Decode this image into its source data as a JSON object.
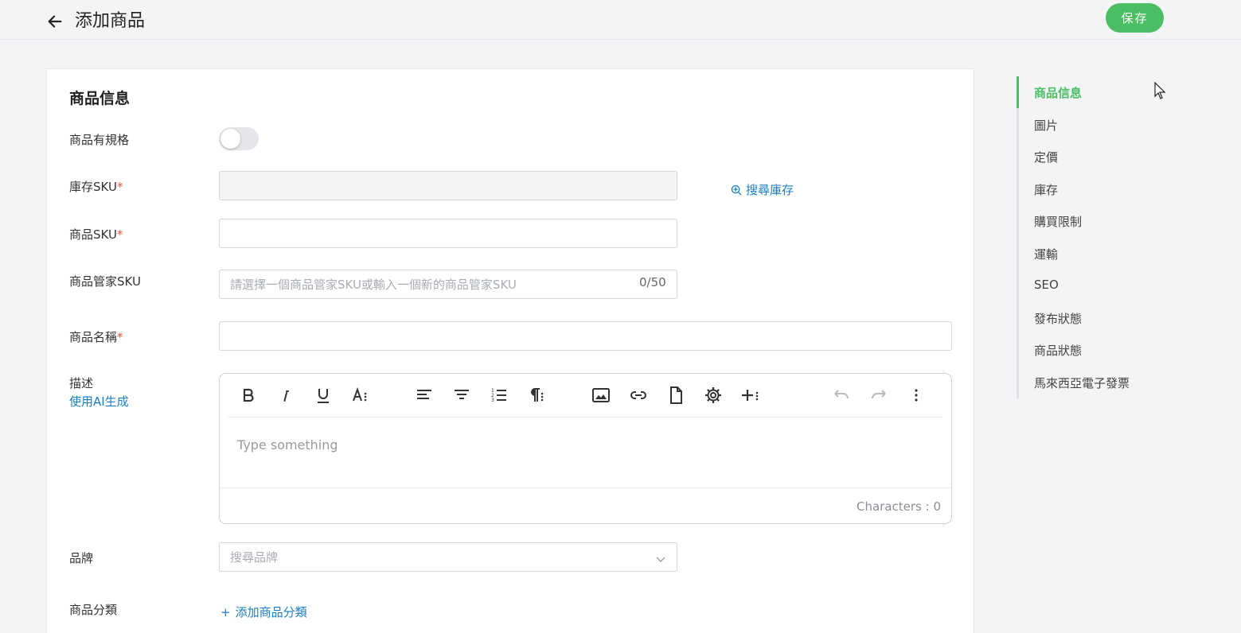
{
  "header": {
    "title": "添加商品",
    "save_label": "保存"
  },
  "form": {
    "section_title": "商品信息",
    "has_spec_label": "商品有規格",
    "stock_sku_label": "庫存SKU",
    "search_stock_label": "搜尋庫存",
    "product_sku_label": "商品SKU",
    "manager_sku_label": "商品管家SKU",
    "manager_sku_placeholder": "請選擇一個商品管家SKU或輸入一個新的商品管家SKU",
    "manager_sku_counter": "0/50",
    "product_name_label": "商品名稱",
    "required_mark": "*",
    "description_label": "描述",
    "ai_generate_label": "使用AI生成",
    "editor_placeholder": "Type something",
    "char_count": "Characters : 0",
    "brand_label": "品牌",
    "brand_placeholder": "搜尋品牌",
    "category_label": "商品分類",
    "add_category_label": "添加商品分類"
  },
  "sidenav": {
    "items": [
      {
        "label": "商品信息",
        "active": true
      },
      {
        "label": "圖片"
      },
      {
        "label": "定價"
      },
      {
        "label": "庫存"
      },
      {
        "label": "購買限制"
      },
      {
        "label": "運輸"
      },
      {
        "label": "SEO"
      },
      {
        "label": "發布狀態"
      },
      {
        "label": "商品狀態"
      },
      {
        "label": "馬來西亞電子發票"
      }
    ]
  },
  "colors": {
    "accent": "#4cbe63",
    "link": "#1a7ec4",
    "required": "#e6553a"
  }
}
